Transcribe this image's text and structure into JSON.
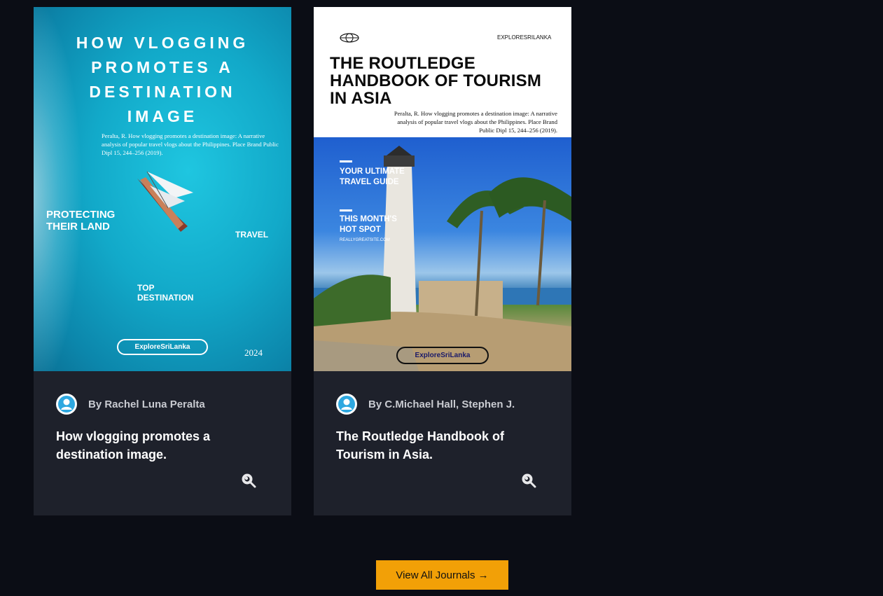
{
  "cards": [
    {
      "cover": {
        "heading_lines": [
          "HOW VLOGGING",
          "PROMOTES A",
          "DESTINATION",
          "IMAGE"
        ],
        "citation": "Peralta, R. How vlogging promotes a destination image: A narrative analysis of popular travel vlogs about the Philippines. Place Brand Public Dipl 15, 244–256 (2019).",
        "tag_protecting": [
          "PROTECTING",
          "THEIR LAND"
        ],
        "tag_travel": "TRAVEL",
        "tag_top": [
          "TOP",
          "DESTINATION"
        ],
        "brand_pill": "ExploreSriLanka",
        "year": "2024"
      },
      "author": "By Rachel Luna Peralta",
      "title": "How vlogging promotes a destination image."
    },
    {
      "cover": {
        "brand_top": "EXPLORESRILANKA",
        "heading_lines": [
          "THE ROUTLEDGE",
          "HANDBOOK OF TOURISM",
          "IN ASIA"
        ],
        "citation": "Peralta, R. How vlogging promotes a destination image: A narrative analysis of popular travel vlogs about the Philippines. Place Brand Public Dipl 15, 244–256 (2019).",
        "guide": [
          "YOUR ULTIMATE",
          "TRAVEL GUIDE"
        ],
        "hotspot": [
          "THIS MONTH'S",
          "HOT SPOT"
        ],
        "site": "REALLYGREATSITE.COM",
        "brand_pill": "ExploreSriLanka"
      },
      "author": "By C.Michael Hall, Stephen J.",
      "title": "The Routledge Handbook of Tourism in Asia."
    }
  ],
  "view_all": "View All Journals →",
  "colors": {
    "background": "#0b0d15",
    "card": "#1e212b",
    "accent": "#f2a007"
  }
}
